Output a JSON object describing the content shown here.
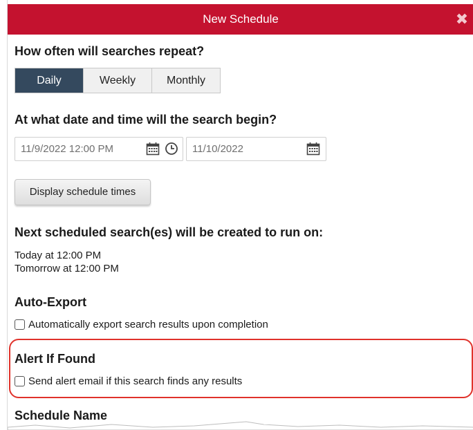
{
  "dialog": {
    "title": "New Schedule",
    "close_icon": "close-icon"
  },
  "repeat": {
    "heading": "How often will searches repeat?",
    "options": [
      "Daily",
      "Weekly",
      "Monthly"
    ],
    "selected": "Daily"
  },
  "begin": {
    "heading": "At what date and time will the search begin?",
    "start_value": "11/9/2022 12:00 PM",
    "end_value": "11/10/2022",
    "calendar_icon": "calendar-icon",
    "clock_icon": "clock-icon"
  },
  "display_button": {
    "label": "Display schedule times"
  },
  "next": {
    "heading": "Next scheduled search(es) will be created to run on:",
    "items": [
      "Today at 12:00 PM",
      "Tomorrow at 12:00 PM"
    ]
  },
  "auto_export": {
    "heading": "Auto-Export",
    "checkbox_label": "Automatically export search results upon completion",
    "checked": false
  },
  "alert": {
    "heading": "Alert If Found",
    "checkbox_label": "Send alert email if this search finds any results",
    "checked": false
  },
  "schedule_name": {
    "heading": "Schedule Name"
  },
  "colors": {
    "titlebar": "#c4122f",
    "selected_segment": "#34495e",
    "highlight": "#e0322b"
  }
}
